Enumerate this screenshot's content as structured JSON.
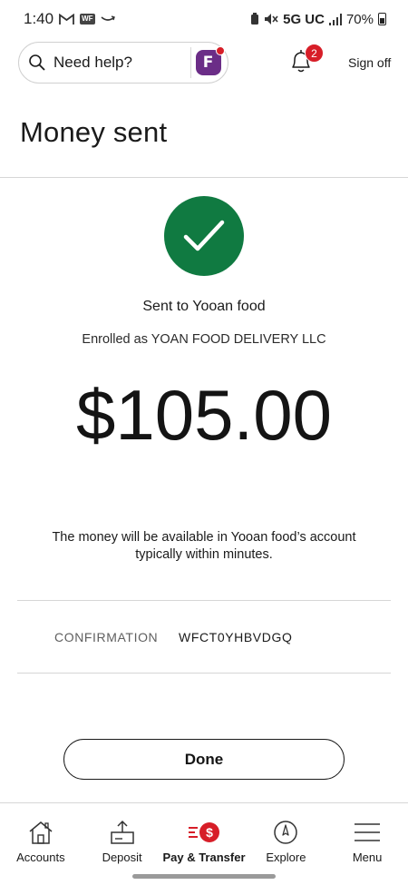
{
  "status_bar": {
    "time": "1:40",
    "network": "5G UC",
    "battery": "70%"
  },
  "header": {
    "search_placeholder": "Need help?",
    "notifications_count": "2",
    "sign_off": "Sign off"
  },
  "page": {
    "title": "Money sent"
  },
  "confirmation": {
    "sent_to": "Sent to Yooan food",
    "enrolled_as": "Enrolled as YOAN FOOD DELIVERY LLC",
    "amount": "$105.00",
    "availability": "The money will be available in Yooan food’s account typically within minutes.",
    "label": "CONFIRMATION",
    "code": "WFCT0YHBVDGQ"
  },
  "actions": {
    "done": "Done"
  },
  "bottom_nav": {
    "items": [
      {
        "label": "Accounts",
        "icon": "home-icon"
      },
      {
        "label": "Deposit",
        "icon": "deposit-icon"
      },
      {
        "label": "Pay & Transfer",
        "icon": "pay-transfer-icon",
        "active": true
      },
      {
        "label": "Explore",
        "icon": "compass-icon"
      },
      {
        "label": "Menu",
        "icon": "menu-icon"
      }
    ]
  },
  "colors": {
    "success_green": "#107a41",
    "brand_red": "#d71e28",
    "fargo_purple": "#6b2d87"
  }
}
